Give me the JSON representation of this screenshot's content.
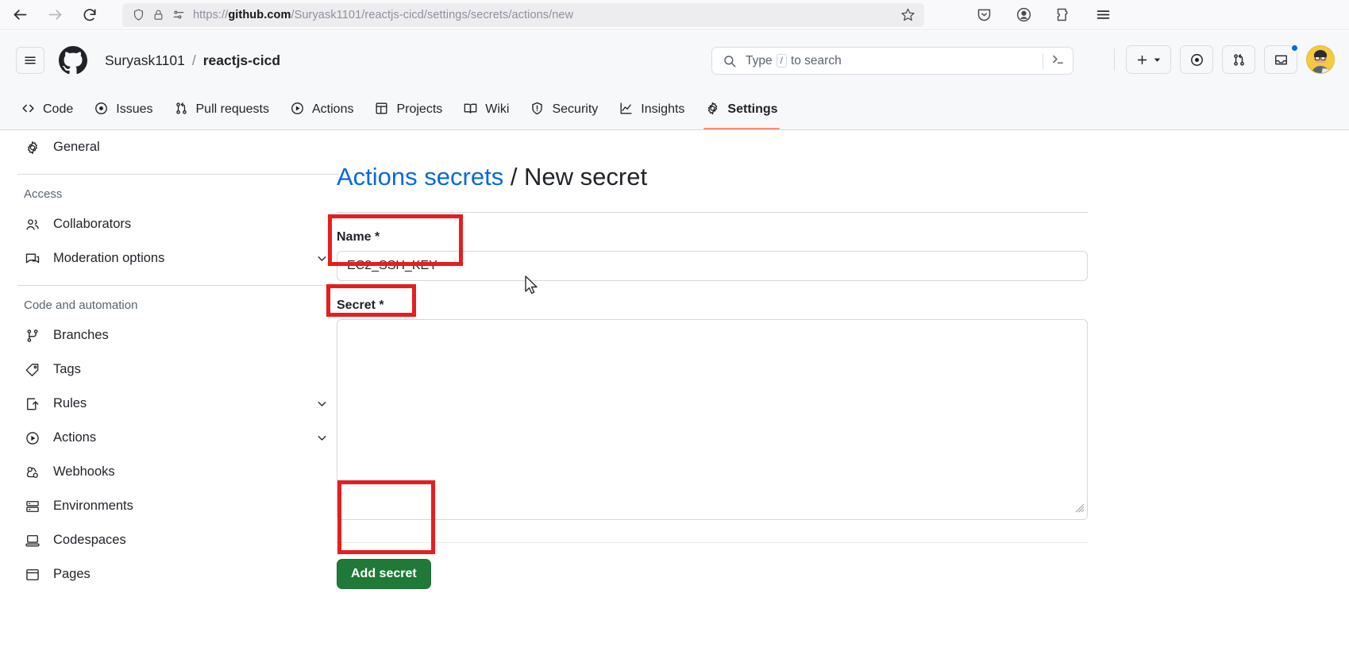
{
  "browser": {
    "url_prefix": "https://",
    "url_domain": "github.com",
    "url_path": "/Suryask1101/reactjs-cicd/settings/secrets/actions/new",
    "url_full": "https://github.com/Suryask1101/reactjs-cicd/settings/secrets/actions/new",
    "nav": {
      "back": "back-icon",
      "forward": "forward-icon",
      "reload": "reload-icon"
    },
    "identity": {
      "shield": "shield-icon",
      "lock": "lock-icon",
      "reader": "reader-view-icon"
    },
    "bookmark": "star-icon",
    "toolbar_right": [
      "pocket-icon",
      "account-icon",
      "extensions-icon",
      "app-menu-icon"
    ]
  },
  "header": {
    "hamburger": "hamburger-icon",
    "logo": "github-logo",
    "owner": "Suryask1101",
    "separator": "/",
    "repo": "reactjs-cicd",
    "search": {
      "placeholder": "Type / to search",
      "slash_key": "/",
      "terminal_icon": "command-palette-icon"
    },
    "actions": {
      "create_label": "+",
      "issues": "issue-opened-icon",
      "pull_requests": "git-pull-request-icon",
      "inbox": "inbox-icon",
      "avatar": "user-avatar"
    }
  },
  "repo_nav": {
    "tabs": [
      {
        "label": "Code",
        "icon": "code-icon",
        "active": false
      },
      {
        "label": "Issues",
        "icon": "issue-opened-icon",
        "active": false
      },
      {
        "label": "Pull requests",
        "icon": "git-pull-request-icon",
        "active": false
      },
      {
        "label": "Actions",
        "icon": "play-icon",
        "active": false
      },
      {
        "label": "Projects",
        "icon": "table-icon",
        "active": false
      },
      {
        "label": "Wiki",
        "icon": "book-icon",
        "active": false
      },
      {
        "label": "Security",
        "icon": "shield-icon",
        "active": false
      },
      {
        "label": "Insights",
        "icon": "graph-icon",
        "active": false
      },
      {
        "label": "Settings",
        "icon": "gear-icon",
        "active": true
      }
    ]
  },
  "sidebar": {
    "top_items": [
      {
        "label": "General",
        "icon": "gear-icon",
        "chevron": false
      }
    ],
    "groups": [
      {
        "title": "Access",
        "items": [
          {
            "label": "Collaborators",
            "icon": "people-icon",
            "chevron": false
          },
          {
            "label": "Moderation options",
            "icon": "comment-discussion-icon",
            "chevron": true
          }
        ]
      },
      {
        "title": "Code and automation",
        "items": [
          {
            "label": "Branches",
            "icon": "git-branch-icon",
            "chevron": false
          },
          {
            "label": "Tags",
            "icon": "tag-icon",
            "chevron": false
          },
          {
            "label": "Rules",
            "icon": "rules-icon",
            "chevron": true
          },
          {
            "label": "Actions",
            "icon": "play-icon",
            "chevron": true
          },
          {
            "label": "Webhooks",
            "icon": "webhook-icon",
            "chevron": false
          },
          {
            "label": "Environments",
            "icon": "server-icon",
            "chevron": false
          },
          {
            "label": "Codespaces",
            "icon": "codespaces-icon",
            "chevron": false
          },
          {
            "label": "Pages",
            "icon": "browser-icon",
            "chevron": false
          }
        ]
      }
    ]
  },
  "main": {
    "title_link": "Actions secrets",
    "title_sep": " / ",
    "title_current": "New secret",
    "name_label": "Name *",
    "name_value": "EC2_SSH_KEY",
    "name_placeholder": "",
    "secret_label": "Secret *",
    "secret_value": "",
    "secret_placeholder": "",
    "submit_label": "Add secret"
  },
  "colors": {
    "accent_blue": "#0969da",
    "green_button": "#1f7a37",
    "annotation_red": "#e81d1d",
    "active_tab_underline": "#fd8c73",
    "header_bg": "#f6f8fa"
  }
}
